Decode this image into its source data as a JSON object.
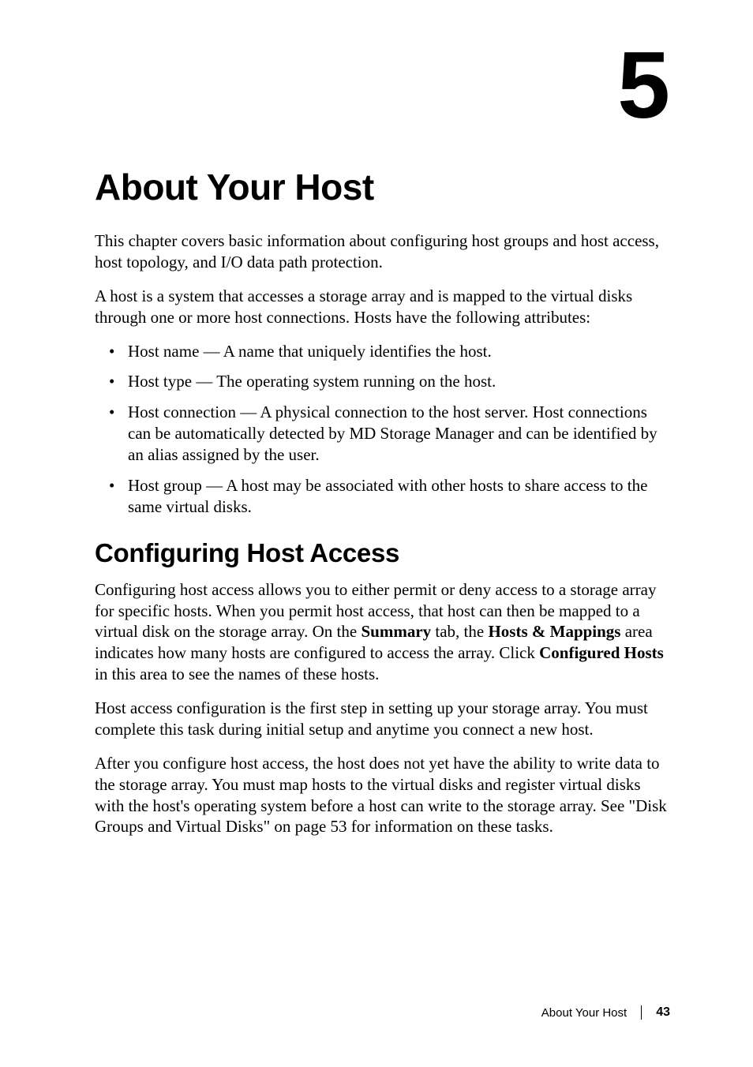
{
  "chapter_number": "5",
  "h1": "About Your Host",
  "intro_p1": "This chapter covers basic information about configuring host groups and host access, host topology, and I/O data path protection.",
  "intro_p2": "A host is a system that accesses a storage array and is mapped to the virtual disks through one or more host connections. Hosts have the following attributes:",
  "bullets": {
    "b1": "Host name — A name that uniquely identifies the host.",
    "b2": "Host type — The operating system running on the host.",
    "b3": "Host connection — A physical connection to the host server. Host connections can be automatically detected by MD Storage Manager and can be identified by an alias assigned by the user.",
    "b4": "Host group — A host may be associated with other hosts to share access to the same virtual disks."
  },
  "h2": "Configuring Host Access",
  "sec_p1_pre": "Configuring host access allows you to either permit or deny access to a storage array for specific hosts. When you permit host access, that host can then be mapped to a virtual disk on the storage array. On the ",
  "sec_p1_bold1": "Summary",
  "sec_p1_mid1": " tab, the ",
  "sec_p1_bold2": "Hosts & Mappings",
  "sec_p1_mid2": " area indicates how many hosts are configured to access the array. Click ",
  "sec_p1_bold3": "Configured Hosts",
  "sec_p1_post": " in this area to see the names of these hosts.",
  "sec_p2": "Host access configuration is the first step in setting up your storage array. You must complete this task during initial setup and anytime you connect a new host.",
  "sec_p3": "After you configure host access, the host does not yet have the ability to write data to the storage array. You must map hosts to the virtual disks and register virtual disks with the host's operating system before a host can write to the storage array. See \"Disk Groups and Virtual Disks\" on page 53 for information on these tasks.",
  "footer_title": "About Your Host",
  "page_number": "43"
}
